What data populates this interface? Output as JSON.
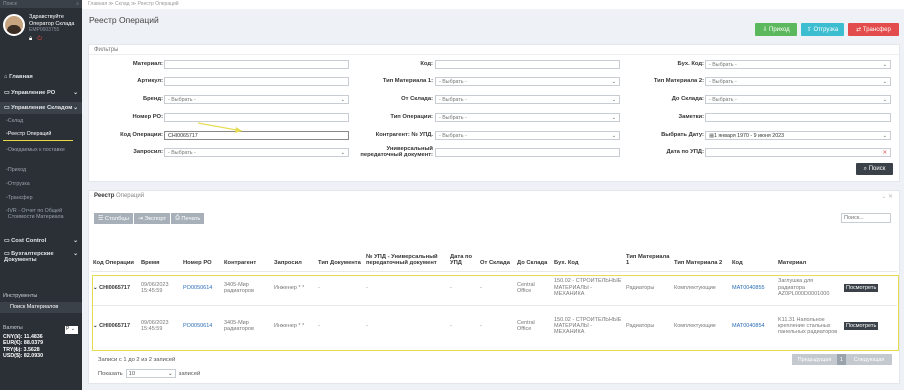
{
  "sidebar": {
    "search": "Поиск",
    "greeting": "Здравствуйте",
    "user_name": "Оператор Склада",
    "user_id": "EMP0003755",
    "nav": [
      {
        "label": "Главная"
      },
      {
        "label": "Управление РО"
      },
      {
        "label": "Управление Складом"
      }
    ],
    "warehouse_items": [
      "Склад",
      "Реестр Операций",
      "Ожидаемых к поставке",
      "Приход",
      "Отгрузка",
      "Трансфер",
      "IVR - Отчет по Общей Стоимости Материала"
    ],
    "nav2": [
      {
        "label": "Cost Control"
      },
      {
        "label": "Бухгалтерские Документы"
      }
    ],
    "tools_label": "Инструменты",
    "tools_search": "Поиск Материалов",
    "rates_title": "Валюты",
    "rates_select": "Р",
    "rates": [
      {
        "label": "CNY(¥): 11.4836"
      },
      {
        "label": "EUR(€): 88.0379"
      },
      {
        "label": "TRY(₺): 3.5628"
      },
      {
        "label": "USD($): 82.0930"
      }
    ]
  },
  "breadcrumb": [
    "Главная",
    "Склад",
    "Реестр Операций"
  ],
  "page_title": "Реестр Операций",
  "buttons": {
    "income": "Приход",
    "shipment": "Отгрузка",
    "transfer": "Трансфер"
  },
  "colors": {
    "income": "#5cb85c",
    "shipment": "#3dbdd0",
    "transfer": "#e34c4c",
    "accent": "#2a6db5",
    "highlight": "#e6dc52"
  },
  "filters": {
    "title": "Фильтры",
    "col1": [
      {
        "label": "Материал:",
        "value": "",
        "dd": false
      },
      {
        "label": "Артикул:",
        "value": "",
        "dd": false
      },
      {
        "label": "Бренд:",
        "value": "- Выбрать -",
        "dd": true
      },
      {
        "label": "Номер РО:",
        "value": "",
        "dd": false
      },
      {
        "label": "Код Операции:",
        "value": "CHI0065717",
        "dd": false
      },
      {
        "label": "Запросил:",
        "value": "- Выбрать -",
        "dd": true
      }
    ],
    "col2": [
      {
        "label": "Код:",
        "value": "",
        "dd": false
      },
      {
        "label": "Тип Материала 1:",
        "value": "- Выбрать -",
        "dd": true
      },
      {
        "label": "От Склада:",
        "value": "- Выбрать -",
        "dd": true
      },
      {
        "label": "Тип Операции:",
        "value": "- Выбрать -",
        "dd": true
      },
      {
        "label": "Контрагент: № УПД.",
        "value": "- Выбрать -",
        "dd": true
      },
      {
        "label": "Универсальный передаточный документ:",
        "value": "",
        "dd": false
      }
    ],
    "col3": [
      {
        "label": "Бух. Код:",
        "value": "- Выбрать -",
        "dd": true
      },
      {
        "label": "Тип Материала 2:",
        "value": "- Выбрать -",
        "dd": true
      },
      {
        "label": "До Склада:",
        "value": "- Выбрать -",
        "dd": true
      },
      {
        "label": "Заметки:",
        "value": "",
        "dd": false
      },
      {
        "label": "Выбрать Дату:",
        "value": "1 января 1970 - 9 июня 2023",
        "dd": true
      },
      {
        "label": "Дата по УПД:",
        "value": "",
        "dd": false
      }
    ],
    "search_button": "Поиск"
  },
  "registry": {
    "title_bold": "Реестр",
    "title_rest": " Операций",
    "tools": [
      "Столбцы",
      "Экспорт",
      "Печать"
    ],
    "search_placeholder": "Поиск...",
    "columns": [
      "Код Операции",
      "Время",
      "Номер РО",
      "Контрагент",
      "Запросил",
      "Тип Документа",
      "№ УПД - Универсальный передаточный документ",
      "Дата по УПД",
      "От Склада",
      "До Склада",
      "Бух. Код",
      "Тип Материала 1",
      "Тип Материала 2",
      "Код",
      "Материал",
      ""
    ],
    "rows": [
      {
        "code": "CHI0065717",
        "time": "09/06/2023 15:45:59",
        "po": "PO0050614",
        "contractor": "3405-Мир радиаторов",
        "requester": "Инженер * *",
        "doc_type": "-",
        "upd": "-",
        "upd_date": "-",
        "from": "-",
        "to": "Central Office",
        "acc_code": "150.02 - СТРОИТЕЛЬНЫЕ МАТЕРИАЛЫ - МЕХАНИКА",
        "mat1": "Радиаторы",
        "mat2": "Комплектующие",
        "mat_code": "MAT0040855",
        "material": "Заглушка для радиатора AZ0PL000D0001000",
        "action": "Посмотреть"
      },
      {
        "code": "CHI0065717",
        "time": "09/06/2023 15:45:59",
        "po": "PO0050614",
        "contractor": "3405-Мир радиаторов",
        "requester": "Инженер * *",
        "doc_type": "-",
        "upd": "-",
        "upd_date": "-",
        "from": "-",
        "to": "Central Office",
        "acc_code": "150.02 - СТРОИТЕЛЬНЫЕ МАТЕРИАЛЫ - МЕХАНИКА",
        "mat1": "Радиаторы",
        "mat2": "Комплектующие",
        "mat_code": "MAT0040854",
        "material": "K11.31 Напольное крепление стальных панельных радиаторов",
        "action": "Посмотреть"
      }
    ],
    "footer_info": "Записи с 1 до 2 из 2 записей",
    "show_label": "Показать",
    "page_size": "10",
    "records_label": "записей",
    "prev": "Предыдущая",
    "page": "1",
    "next": "Следующая"
  }
}
